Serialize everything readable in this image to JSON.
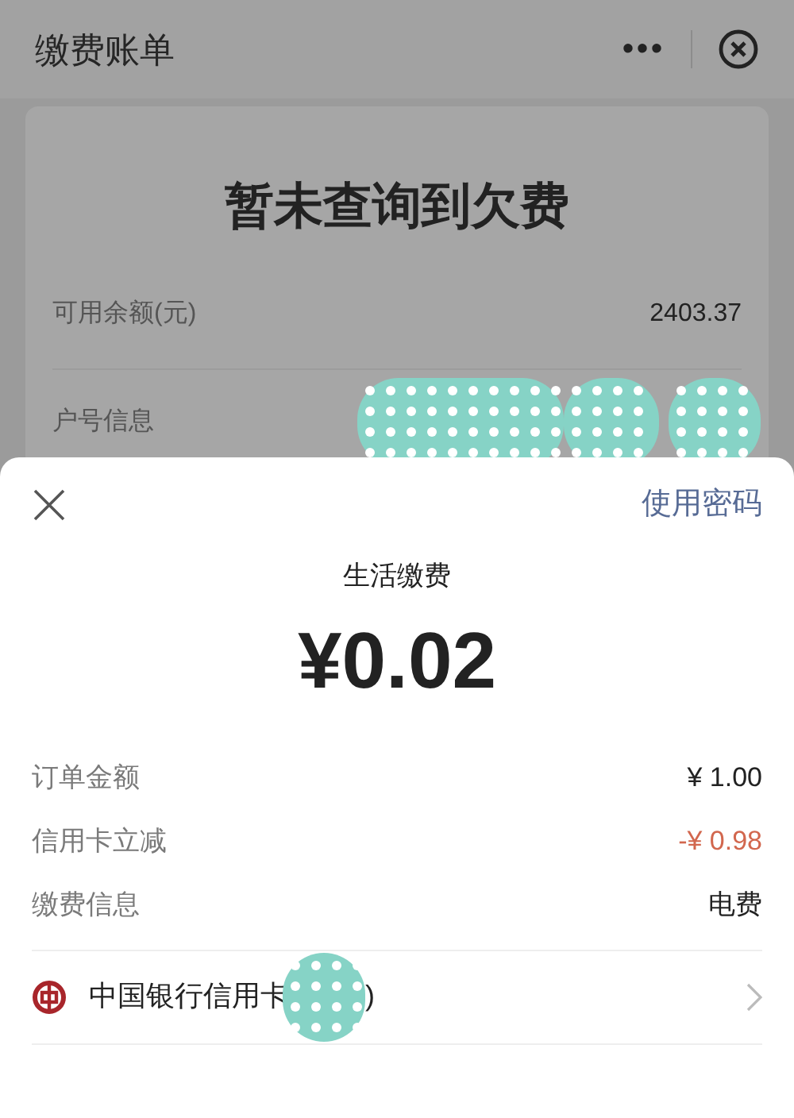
{
  "header": {
    "title": "缴费账单",
    "more": "•••"
  },
  "bill": {
    "status": "暂未查询到欠费",
    "rows": [
      {
        "label": "可用余额(元)",
        "value": "2403.37",
        "kind": "text"
      },
      {
        "label": "户号信息",
        "kind": "redacted"
      }
    ]
  },
  "sheet": {
    "use_password": "使用密码",
    "merchant": "生活缴费",
    "amount": "¥0.02",
    "details": [
      {
        "label": "订单金额",
        "value": "¥ 1.00",
        "kind": "normal"
      },
      {
        "label": "信用卡立减",
        "value": "-¥ 0.98",
        "kind": "discount"
      },
      {
        "label": "缴费信息",
        "value": "电费",
        "kind": "normal"
      }
    ],
    "payment": {
      "card": "中国银行信用卡",
      "suffix": ")"
    }
  }
}
